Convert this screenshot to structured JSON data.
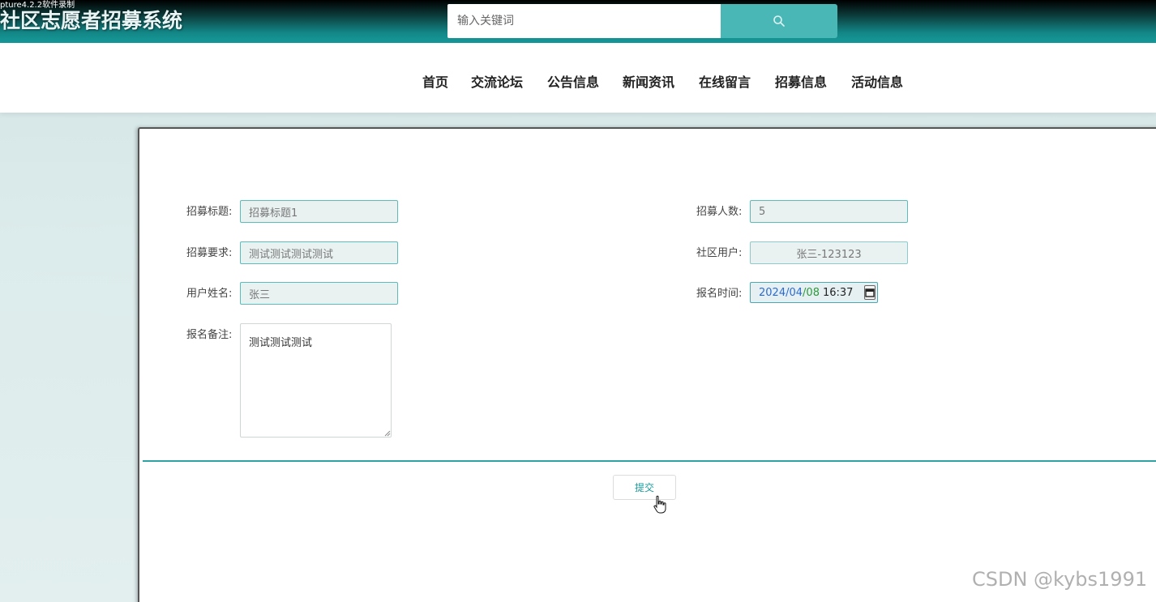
{
  "recorder_note": "pture4.2.2软件录制",
  "header": {
    "title": "社区志愿者招募系统",
    "search_placeholder": "输入关键词",
    "search_icon": "search-icon"
  },
  "nav": {
    "items": [
      "首页",
      "交流论坛",
      "公告信息",
      "新闻资讯",
      "在线留言",
      "招募信息",
      "活动信息"
    ]
  },
  "form": {
    "title_label": "招募标题:",
    "title_value": "招募标题1",
    "count_label": "招募人数:",
    "count_value": "5",
    "requirement_label": "招募要求:",
    "requirement_value": "测试测试测试测试",
    "community_user_label": "社区用户:",
    "community_user_value": "张三-123123",
    "user_name_label": "用户姓名:",
    "user_name_value": "张三",
    "signup_time_label": "报名时间:",
    "signup_time": {
      "year": "2024",
      "month": "04",
      "day": "08",
      "time": "16:37"
    },
    "remark_label": "报名备注:",
    "remark_value": "测试测试测试",
    "submit_label": "提交"
  },
  "watermark": "CSDN @kybs1991",
  "colors": {
    "accent": "#169a9a",
    "search_button": "#4ab7b7",
    "divider": "#2fa3a3"
  }
}
